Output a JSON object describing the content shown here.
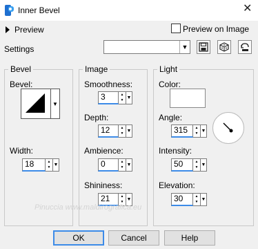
{
  "window": {
    "title": "Inner Bevel"
  },
  "header": {
    "preview_label": "Preview",
    "preview_on_image_label": "Preview on Image",
    "preview_on_image_checked": false
  },
  "settings": {
    "label": "Settings",
    "value": ""
  },
  "bevel_group": {
    "title": "Bevel",
    "bevel_label": "Bevel:",
    "width_label": "Width:",
    "width_value": "18"
  },
  "image_group": {
    "title": "Image",
    "smoothness_label": "Smoothness:",
    "smoothness_value": "3",
    "depth_label": "Depth:",
    "depth_value": "12",
    "ambience_label": "Ambience:",
    "ambience_value": "0",
    "shininess_label": "Shininess:",
    "shininess_value": "21"
  },
  "light_group": {
    "title": "Light",
    "color_label": "Color:",
    "color_value": "#ffffff",
    "angle_label": "Angle:",
    "angle_value": "315",
    "intensity_label": "Intensity:",
    "intensity_value": "50",
    "elevation_label": "Elevation:",
    "elevation_value": "30"
  },
  "watermark": "Pinuccia www.maldirografica.eu",
  "buttons": {
    "ok": "OK",
    "cancel": "Cancel",
    "help": "Help"
  }
}
